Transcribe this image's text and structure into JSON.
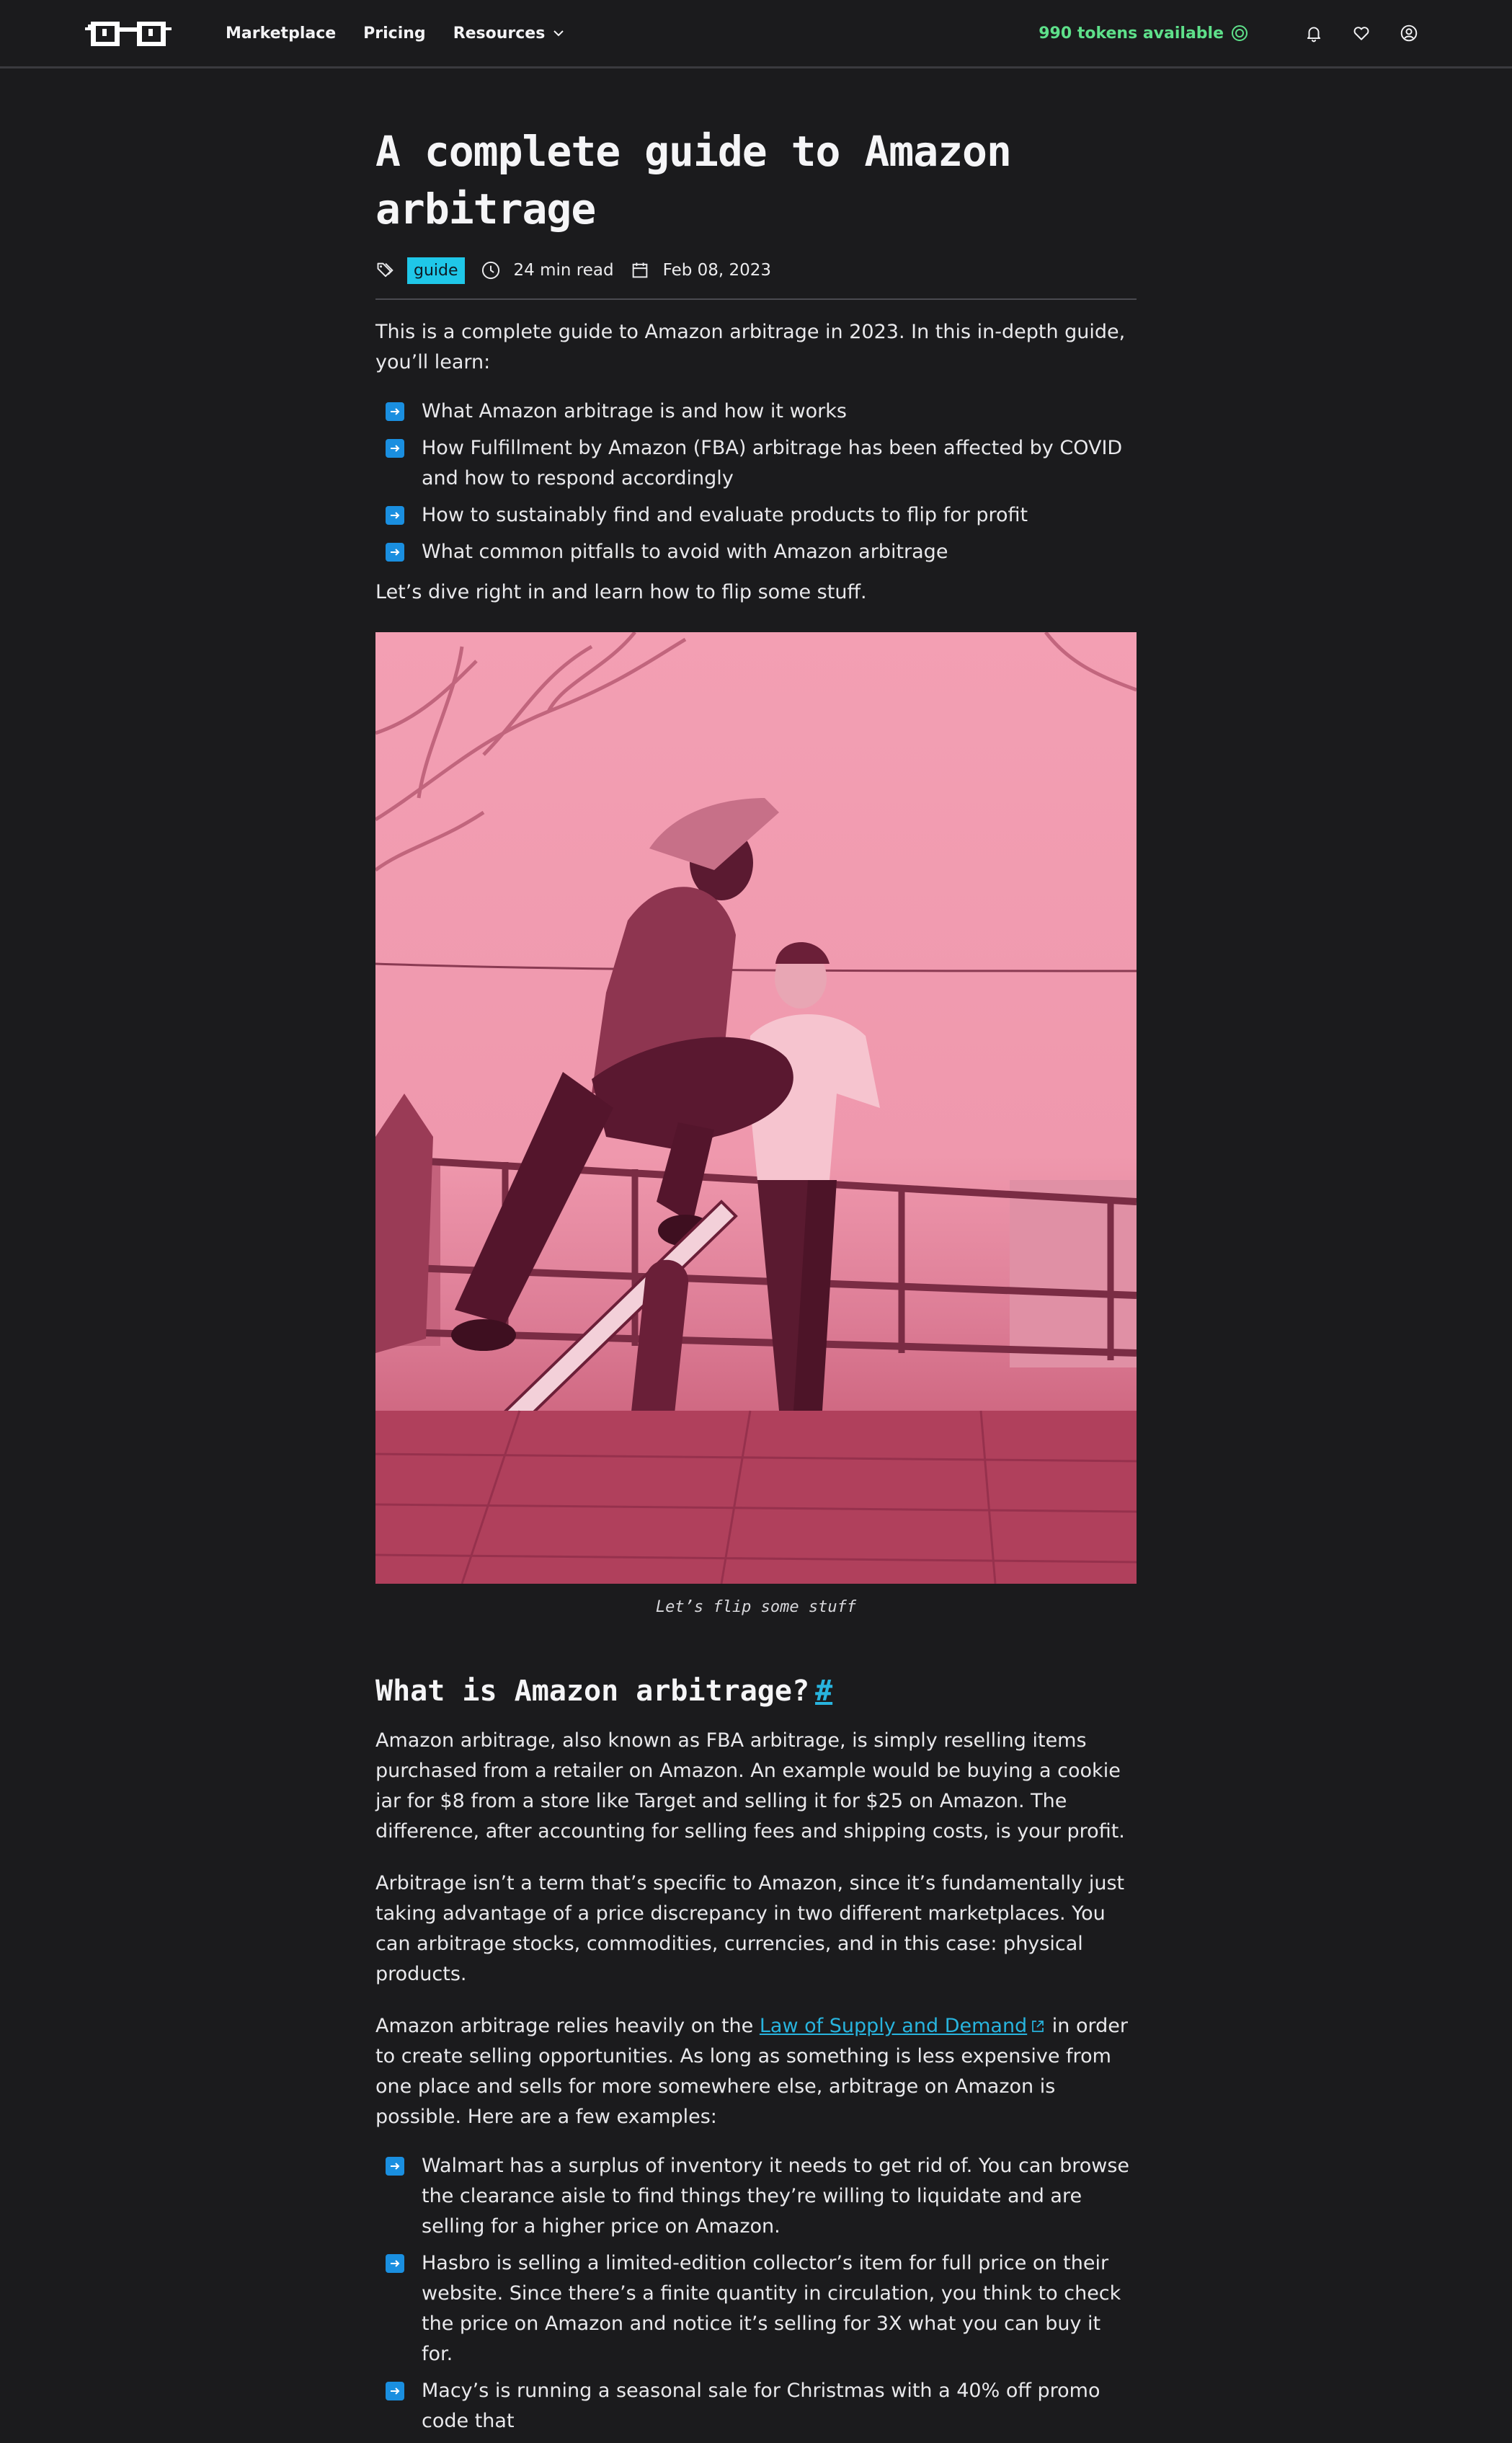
{
  "nav": {
    "logo_icon": "glasses-logo-icon",
    "links": [
      "Marketplace",
      "Pricing",
      "Resources"
    ],
    "tokens": "990 tokens available",
    "token_icon": "coin-icon",
    "icons": [
      "bell-icon",
      "heart-icon",
      "user-circle-icon"
    ]
  },
  "article": {
    "title": "A complete guide to Amazon arbitrage",
    "tag": "guide",
    "read_time": "24 min read",
    "date": "Feb 08, 2023",
    "intro": "This is a complete guide to Amazon arbitrage in 2023. In this in-depth guide, you’ll learn:",
    "learn_items": [
      "What Amazon arbitrage is and how it works",
      "How Fulfillment by Amazon (FBA) arbitrage has been affected by COVID and how to respond accordingly",
      "How to sustainably find and evaluate products to flip for profit",
      "What common pitfalls to avoid with Amazon arbitrage"
    ],
    "dive_in": "Let’s dive right in and learn how to flip some stuff.",
    "image_caption": "Let’s flip some stuff",
    "section_heading": "What is Amazon arbitrage?",
    "section_anchor": "#",
    "para1": "Amazon arbitrage, also known as FBA arbitrage, is simply reselling items purchased from a retailer on Amazon. An example would be buying a cookie jar for $8 from a store like Target and selling it for $25 on Amazon. The difference, after accounting for selling fees and shipping costs, is your profit.",
    "para2": "Arbitrage isn’t a term that’s specific to Amazon, since it’s fundamentally just taking advantage of a price discrepancy in two different marketplaces. You can arbitrage stocks, commodities, currencies, and in this case: physical products.",
    "para3_before": "Amazon arbitrage relies heavily on the ",
    "para3_link": "Law of Supply and Demand",
    "para3_after": " in order to create selling opportunities. As long as something is less expensive from one place and sells for more somewhere else, arbitrage on Amazon is possible. Here are a few examples:",
    "examples": [
      "Walmart has a surplus of inventory it needs to get rid of. You can browse the clearance aisle to find things they’re willing to liquidate and are selling for a higher price on Amazon.",
      "Hasbro is selling a limited-edition collector’s item for full price on their website. Since there’s a finite quantity in circulation, you think to check the price on Amazon and notice it’s selling for 3X what you can buy it for.",
      "Macy’s is running a seasonal sale for Christmas with a 40% off promo code that"
    ]
  },
  "colors": {
    "background": "#1b1b1d",
    "accent_link": "#28b4de",
    "tag_bg": "#1fc7e8",
    "tokens_green": "#5ee08a",
    "bullet_blue": "#1a8fe0",
    "image_tint": "#f194ab"
  }
}
